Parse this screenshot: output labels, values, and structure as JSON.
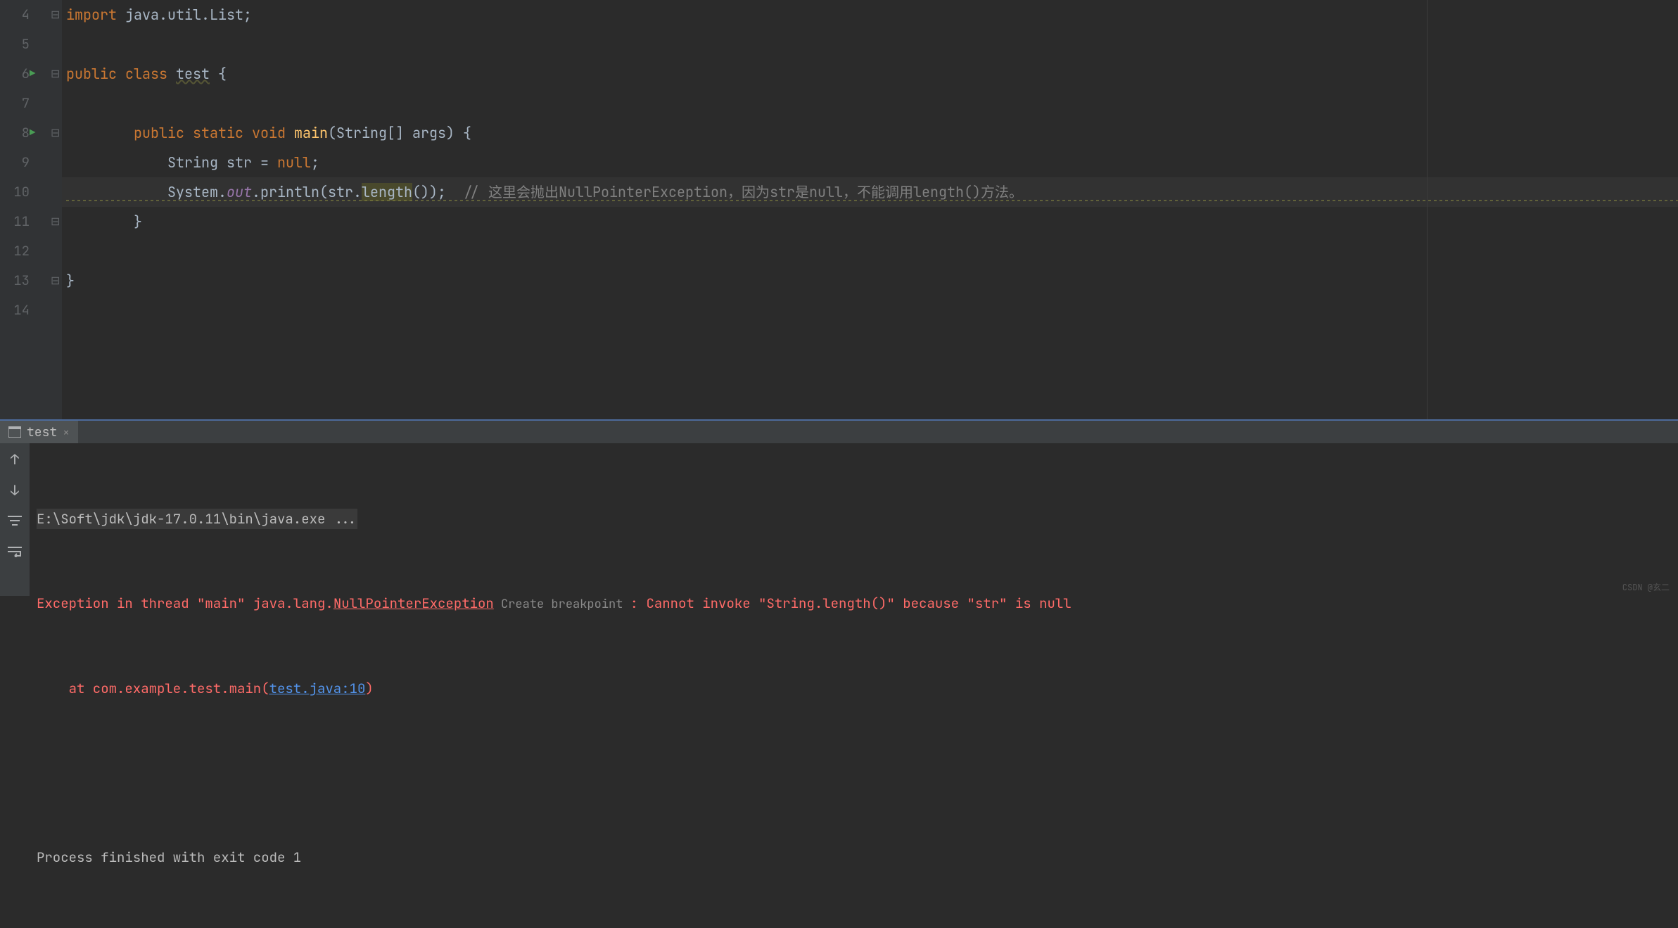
{
  "editor": {
    "lineStart": 4,
    "runIconLines": [
      6,
      8
    ],
    "foldMarks": {
      "4": "⊟",
      "6": "⊟",
      "8": "⊟",
      "11": "⊟",
      "13": "⊟"
    },
    "currentLine": 10,
    "code": {
      "l4_import": "import",
      "l4_pkg": " java.util.List;",
      "l6_public": "public ",
      "l6_class": "class ",
      "l6_name": "test",
      "l6_brace": " {",
      "l8_indent": "        ",
      "l8_public": "public ",
      "l8_static": "static ",
      "l8_void": "void ",
      "l8_main": "main",
      "l8_sig": "(String[] args) {",
      "l9_indent": "            String str = ",
      "l9_null": "null",
      "l9_semi": ";",
      "l10_indent": "            System.",
      "l10_out": "out",
      "l10_dot": ".println(str.",
      "l10_len": "length",
      "l10_close": "());  ",
      "l10_cmt": "// 这里会抛出NullPointerException，因为str是null，不能调用length()方法。",
      "l11": "        }",
      "l13": "}"
    }
  },
  "tab": {
    "label": "test",
    "close": "×"
  },
  "console": {
    "cmd": "E:\\Soft\\jdk\\jdk-17.0.11\\bin\\java.exe ...",
    "exc_pre": "Exception in thread \"main\" java.lang.",
    "exc_type": "NullPointerException",
    "create_bp": " Create breakpoint ",
    "exc_msg": ": Cannot invoke \"String.length()\" because \"str\" is null",
    "at_pre": "    at com.example.test.main(",
    "at_link": "test.java:10",
    "at_close": ")",
    "exit": "Process finished with exit code 1"
  },
  "watermark": "CSDN @玄二"
}
